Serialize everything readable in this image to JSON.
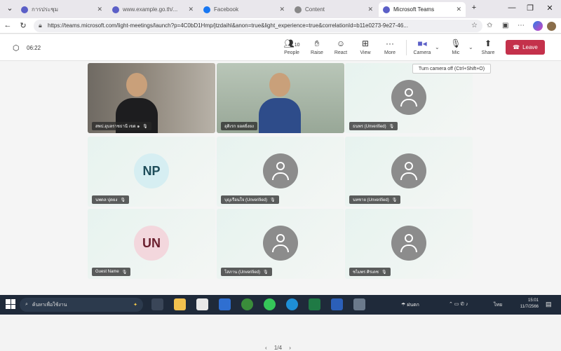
{
  "browser": {
    "tabs": [
      {
        "title": "การประชุม",
        "active": false,
        "fav_color": "#5b5fc7"
      },
      {
        "title": "www.example.go.th/...",
        "active": false,
        "fav_color": "#5b5fc7"
      },
      {
        "title": "Facebook",
        "active": false,
        "fav_color": "#1877f2"
      },
      {
        "title": "Content",
        "active": false,
        "fav_color": "#888888"
      },
      {
        "title": "Microsoft Teams",
        "active": true,
        "fav_color": "#5b5fc7"
      }
    ],
    "new_tab_label": "+",
    "window_controls": {
      "minimize": "—",
      "maximize": "❐",
      "close": "✕"
    },
    "url": "https://teams.microsoft.com/light-meetings/launch?p=4C0bD1Hmp/jtzdaihl&anon=true&light_experience=true&correlationId=b11e0273-9e27-46...",
    "nav": {
      "back": "←",
      "refresh": "↻"
    }
  },
  "meeting": {
    "timer": "06:22",
    "toolbar": {
      "people": {
        "label": "People",
        "count": "10"
      },
      "raise": {
        "label": "Raise"
      },
      "react": {
        "label": "React"
      },
      "view": {
        "label": "View"
      },
      "more": {
        "label": "More"
      },
      "camera": {
        "label": "Camera"
      },
      "mic": {
        "label": "Mic"
      },
      "share": {
        "label": "Share"
      },
      "leave": {
        "label": "Leave"
      }
    },
    "tooltip": "Turn camera off (Ctrl+Shift+O)",
    "participants": [
      {
        "name": "สพป.อุบลราชธานี เขต ๑",
        "type": "video",
        "muted": true
      },
      {
        "name": "อุดิเรก ยอดยิ่งยง",
        "type": "video",
        "muted": false
      },
      {
        "name": "ธนพร (Unverified)",
        "type": "ghost",
        "muted": true
      },
      {
        "name": "นพดล ปุดยง",
        "type": "initials",
        "initials": "NP",
        "bg": "#d6eef2",
        "fg": "#1e4d5a",
        "muted": true
      },
      {
        "name": "บุญเรือนใจ (Unverified)",
        "type": "ghost",
        "muted": true
      },
      {
        "name": "นทชาย (Unverified)",
        "type": "ghost",
        "muted": true
      },
      {
        "name": "Guest Name",
        "type": "initials",
        "initials": "UN",
        "bg": "#f3d7dd",
        "fg": "#6b1f2e",
        "muted": true
      },
      {
        "name": "โสภาน (Unverified)",
        "type": "ghost",
        "muted": true
      },
      {
        "name": "ชไมพร ศิรเดช",
        "type": "ghost",
        "muted": true
      }
    ],
    "pager": {
      "prev": "‹",
      "text": "1/4",
      "next": "›"
    }
  },
  "taskbar": {
    "search_placeholder": "ค้นหาเพื่อใช้งาน",
    "weather": "ฝนตก",
    "lang": "ไทย",
    "time": "15:01",
    "date": "11/7/2566"
  },
  "colors": {
    "accent": "#5b5fc7",
    "leave": "#c4314b",
    "taskbar": "#1f2a3a"
  }
}
